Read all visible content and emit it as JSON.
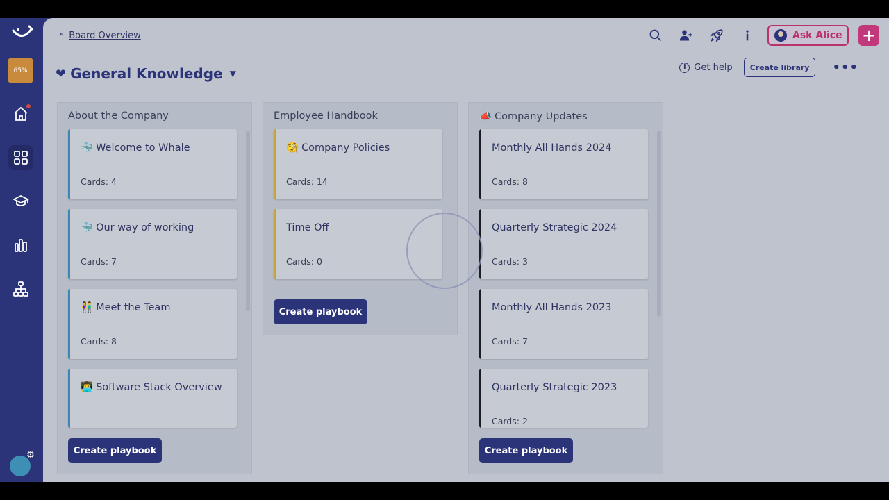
{
  "sidebar": {
    "progress": "65%",
    "items": [
      {
        "icon": "home-icon",
        "active": false
      },
      {
        "icon": "grid-icon",
        "active": true
      },
      {
        "icon": "graduation-cap-icon",
        "active": false
      },
      {
        "icon": "bar-chart-icon",
        "active": false
      },
      {
        "icon": "org-chart-icon",
        "active": false
      }
    ]
  },
  "breadcrumb": {
    "label": "Board Overview"
  },
  "header": {
    "ask_label": "Ask Alice",
    "plus_label": "+"
  },
  "page": {
    "title": "General Knowledge",
    "get_help": "Get help",
    "create_library": "Create library",
    "more": "•••"
  },
  "columns": [
    {
      "title": "About the Company",
      "cards": [
        {
          "emoji": "🐳",
          "title": "Welcome to Whale",
          "count": "Cards: 4"
        },
        {
          "emoji": "🐳",
          "title": "Our way of working",
          "count": "Cards: 7"
        },
        {
          "emoji": "👫",
          "title": "Meet the Team",
          "count": "Cards: 8"
        },
        {
          "emoji": "👨‍💻",
          "title": "Software Stack Overview",
          "count": ""
        }
      ],
      "button": "Create playbook"
    },
    {
      "title": "Employee Handbook",
      "cards": [
        {
          "emoji": "🧐",
          "title": "Company Policies",
          "count": "Cards: 14"
        },
        {
          "emoji": "",
          "title": "Time Off",
          "count": "Cards: 0"
        }
      ],
      "button": "Create playbook"
    },
    {
      "title": "Company Updates",
      "title_emoji": "📣",
      "cards": [
        {
          "emoji": "",
          "title": "Monthly All Hands 2024",
          "count": "Cards: 8"
        },
        {
          "emoji": "",
          "title": "Quarterly Strategic 2024",
          "count": "Cards: 3"
        },
        {
          "emoji": "",
          "title": "Monthly All Hands 2023",
          "count": "Cards: 7"
        },
        {
          "emoji": "",
          "title": "Quarterly Strategic 2023",
          "count": "Cards: 2"
        }
      ],
      "button": "Create playbook"
    }
  ]
}
